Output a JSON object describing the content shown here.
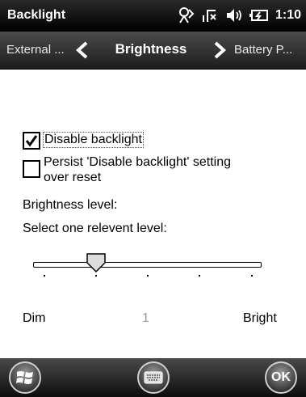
{
  "title_bar": {
    "app_title": "Backlight",
    "time": "1:10",
    "icons": [
      "connectivity-icon",
      "signal-off-icon",
      "volume-icon",
      "battery-icon"
    ]
  },
  "tabs": {
    "previous": "External ...",
    "current": "Brightness",
    "next": "Battery P..."
  },
  "content": {
    "disable_backlight": {
      "label": "Disable backlight",
      "checked": true
    },
    "persist_setting": {
      "label_line1": "Persist 'Disable backlight' setting",
      "label_line2": "over reset",
      "checked": false
    },
    "brightness_heading": "Brightness level:",
    "select_heading": "Select one relevent level:",
    "slider": {
      "min_label": "Dim",
      "max_label": "Bright",
      "value": "1",
      "ticks": 5
    }
  },
  "softkeys": {
    "ok_label": "OK",
    "left_icon": "windows-start-icon",
    "center_icon": "keyboard-icon"
  },
  "colors": {
    "accent_focus": "#1a4fc0",
    "value_text": "#9a9a9a"
  }
}
